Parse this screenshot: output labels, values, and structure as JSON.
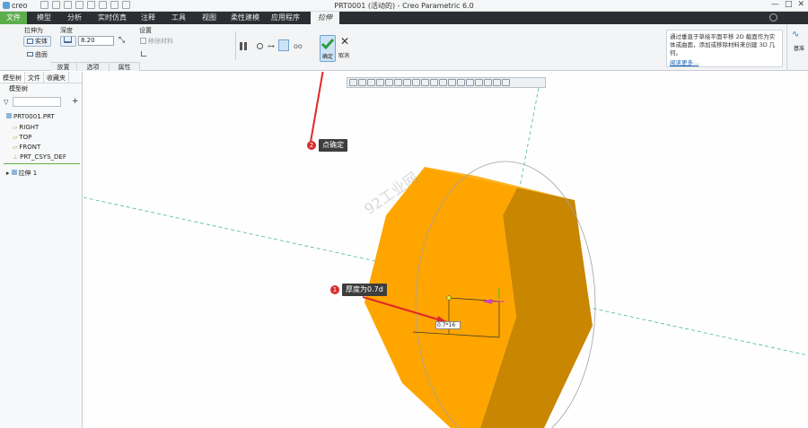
{
  "app": {
    "logo": "creo",
    "title": "PRT0001 (活动的) - Creo Parametric 6.0",
    "window_controls": [
      "—",
      "□",
      "✕"
    ]
  },
  "menu": {
    "tabs": [
      "文件",
      "模型",
      "分析",
      "实时仿真",
      "注释",
      "工具",
      "视图",
      "柔性建模",
      "应用程序",
      "拉伸"
    ],
    "active": "拉伸"
  },
  "ribbon": {
    "extrude_as_label": "拉伸为",
    "solid_button": "实体",
    "surface_button": "曲面",
    "depth_label": "深度",
    "depth_value": "8.20",
    "settings_label": "设置",
    "remove_material": "移除材料",
    "ok_label": "确定",
    "cancel_label": "取消",
    "groups": [
      "放置",
      "选项",
      "属性"
    ],
    "hint_text": "通过垂直于草绘平面平移 2D 截面作为实体或曲面，添加或移除材料来创建 3D 几何。",
    "hint_more": "阅读更多...",
    "datum_label": "基准"
  },
  "model_tree": {
    "tabs": [
      "模型树",
      "文件",
      "收藏夹"
    ],
    "toolbar_label": "模型树",
    "items": [
      "PRT0001.PRT",
      "RIGHT",
      "TOP",
      "FRONT",
      "PRT_CSYS_DEF",
      "拉伸 1"
    ]
  },
  "canvas": {
    "dimension_value": "0.7*16",
    "watermark": "92工业网",
    "callout1_num": "1",
    "callout1": "厚度为0.7d",
    "callout2_num": "2",
    "callout2": "点确定"
  },
  "colors": {
    "body": "#ffa500",
    "body_side": "#c87e00",
    "accent_green": "#5cae4c",
    "annotation_red": "#e02828"
  }
}
